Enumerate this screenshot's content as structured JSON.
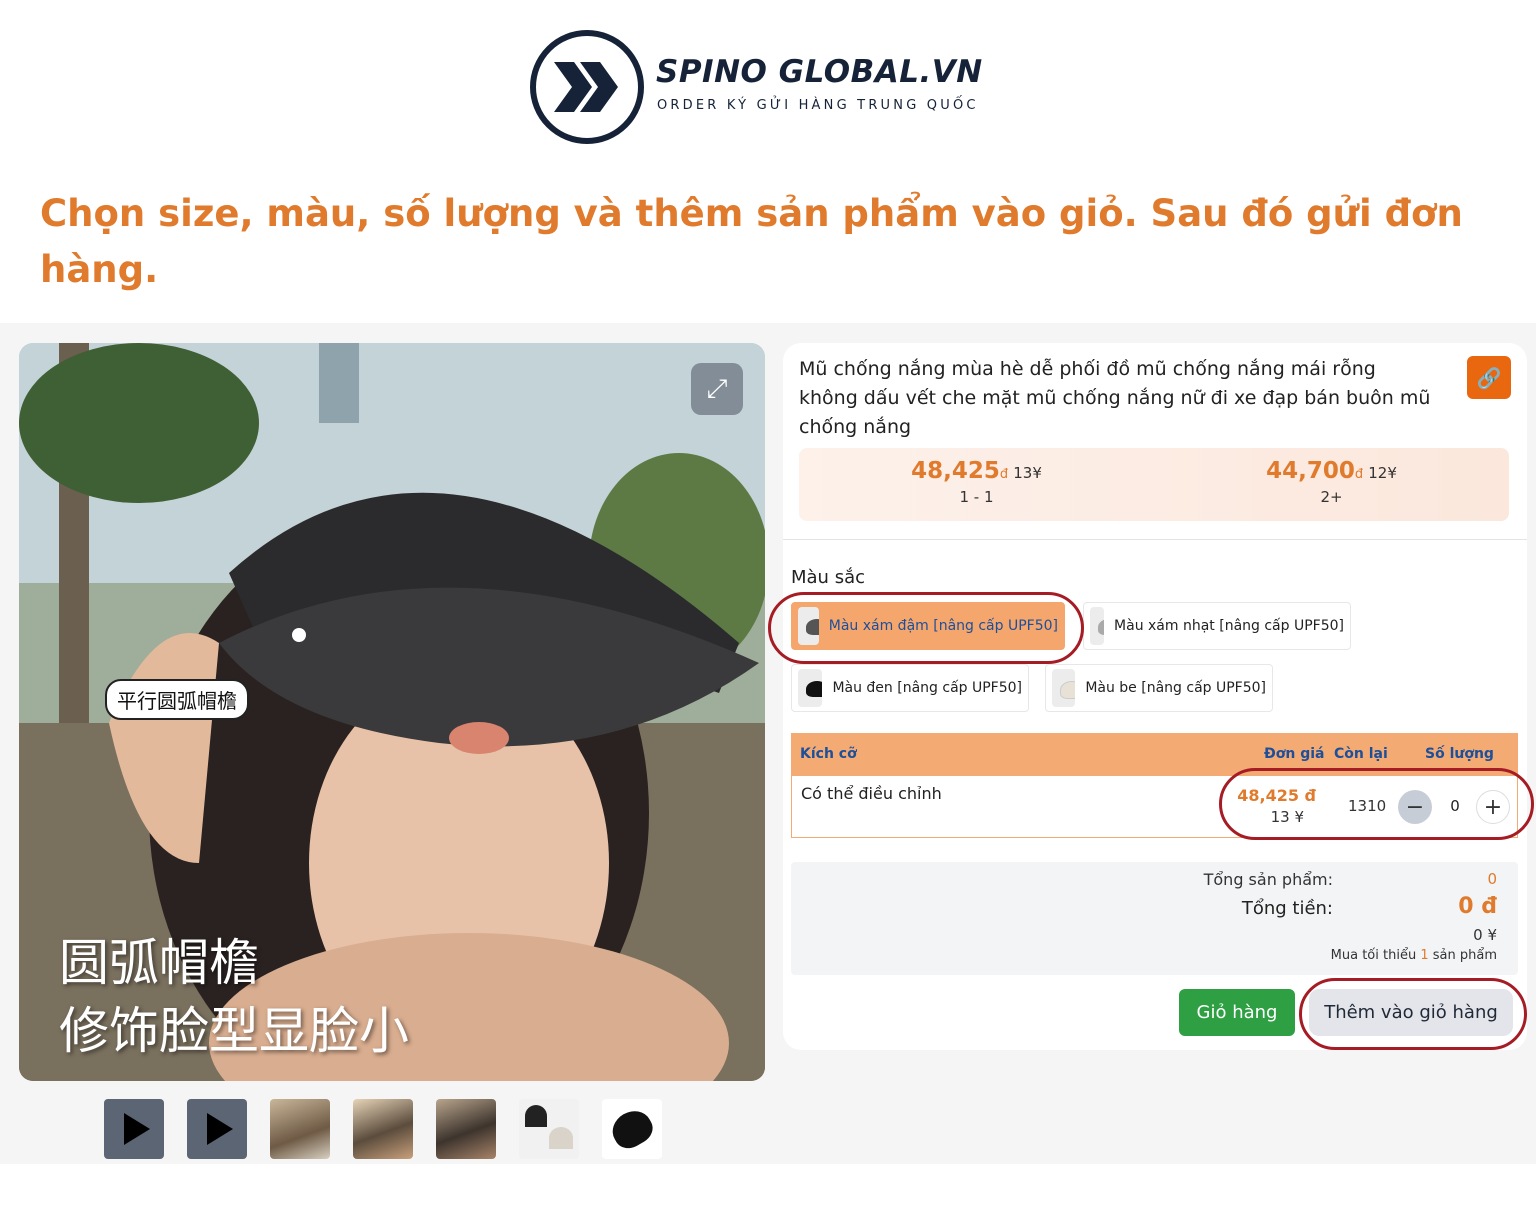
{
  "brand": {
    "name": "SPINO GLOBAL.VN",
    "tagline": "ORDER KÝ GỬI HÀNG TRUNG QUỐC",
    "color": "#152238"
  },
  "headline": {
    "text": "Chọn size, màu, số lượng và thêm sản phẩm vào giỏ. Sau đó gửi đơn hàng.",
    "color": "#e07a2c"
  },
  "gallery": {
    "expand_icon": "expand-icon",
    "caption_small": "平行圆弧帽檐",
    "caption_line1": "圆弧帽檐",
    "caption_line2": "修饰脸型显脸小",
    "thumbnails": [
      {
        "kind": "video",
        "icon": "play-icon"
      },
      {
        "kind": "video",
        "icon": "play-icon"
      },
      {
        "kind": "image"
      },
      {
        "kind": "image"
      },
      {
        "kind": "image"
      },
      {
        "kind": "image"
      },
      {
        "kind": "image"
      }
    ]
  },
  "product": {
    "title": "Mũ chống nắng mùa hè dễ phối đồ mũ chống nắng mái rỗng không dấu vết che mặt mũ chống nắng nữ đi xe đạp bán buôn mũ chống nắng",
    "link_icon": "link-icon",
    "tiers": [
      {
        "vnd": "48,425",
        "unit": "đ",
        "cny": "13¥",
        "range": "1 - 1"
      },
      {
        "vnd": "44,700",
        "unit": "đ",
        "cny": "12¥",
        "range": "2+"
      }
    ]
  },
  "colors": {
    "label": "Màu sắc",
    "options": [
      {
        "label": "Màu xám đậm [nâng cấp UPF50]",
        "selected": true
      },
      {
        "label": "Màu xám nhạt [nâng cấp UPF50]",
        "selected": false
      },
      {
        "label": "Màu đen [nâng cấp UPF50]",
        "selected": false
      },
      {
        "label": "Màu be [nâng cấp UPF50]",
        "selected": false
      }
    ],
    "accent": "#f4a66c"
  },
  "table": {
    "headers": {
      "size": "Kích cỡ",
      "price": "Đơn giá",
      "stock": "Còn lại",
      "qty": "Số lượng"
    },
    "rows": [
      {
        "size": "Có thể điều chỉnh",
        "price_vnd": "48,425 đ",
        "price_cny": "13 ¥",
        "stock": "1310",
        "qty": "0"
      }
    ]
  },
  "summary": {
    "total_items_label": "Tổng sản phẩm:",
    "total_items": "0",
    "total_money_label": "Tổng tiền:",
    "total_money": "0 đ",
    "total_cny": "0 ¥",
    "min_prefix": "Mua tối thiểu",
    "min_value": "1",
    "min_suffix": "sản phẩm"
  },
  "actions": {
    "cart": "Giỏ hàng",
    "add_to_cart": "Thêm vào giỏ hàng",
    "cart_color": "#2ea043"
  },
  "annotation_color": "#a51c24"
}
